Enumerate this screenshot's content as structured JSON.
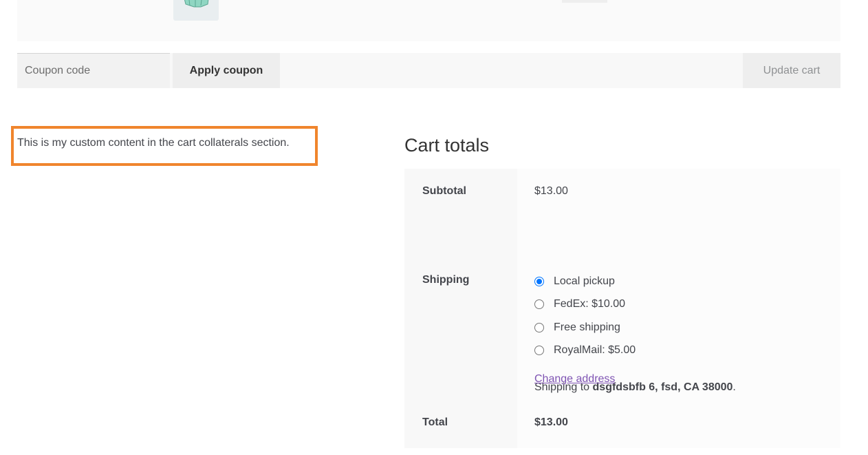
{
  "cart": {
    "coupon": {
      "placeholder": "Coupon code",
      "value": ""
    },
    "apply_coupon_label": "Apply coupon",
    "update_cart_label": "Update cart",
    "product_image_icon": "hoodie-product-thumbnail"
  },
  "collaterals": {
    "custom_text": "This is my custom content in the cart collaterals section.",
    "highlight_color": "#f0852d"
  },
  "totals": {
    "heading": "Cart totals",
    "subtotal_label": "Subtotal",
    "subtotal_value": "$13.00",
    "shipping_label": "Shipping",
    "shipping_options": [
      {
        "label": "Local pickup",
        "selected": true
      },
      {
        "label": "FedEx: $10.00",
        "selected": false
      },
      {
        "label": "Free shipping",
        "selected": false
      },
      {
        "label": "RoyalMail: $5.00",
        "selected": false
      }
    ],
    "shipping_to_prefix": "Shipping to",
    "shipping_to_address": "dsgfdsbfb 6, fsd, CA 38000",
    "shipping_to_suffix": ".",
    "change_address_label": "Change address",
    "total_label": "Total",
    "total_value": "$13.00",
    "link_color": "#7f54b3",
    "radio_accent": "#0075ff"
  }
}
